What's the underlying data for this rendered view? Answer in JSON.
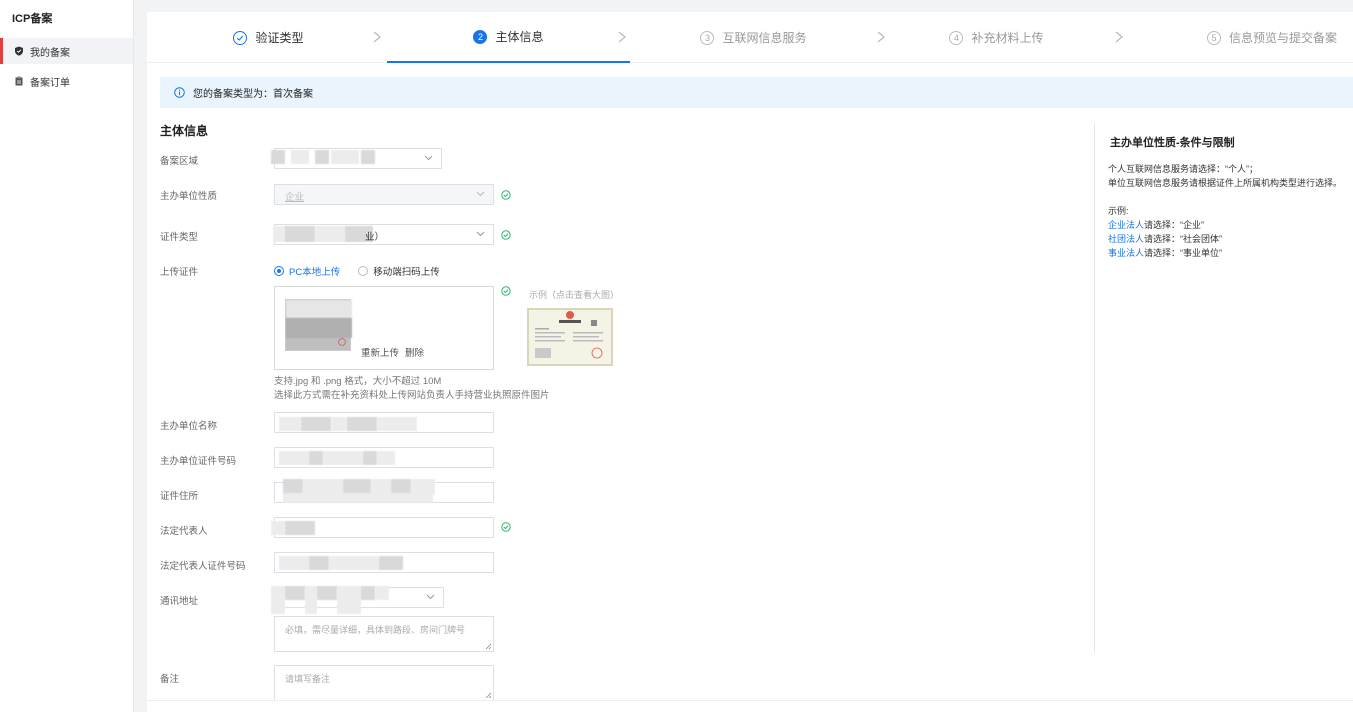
{
  "sidebar": {
    "title": "ICP备案",
    "items": [
      {
        "label": "我的备案",
        "icon": "shield-icon",
        "active": true
      },
      {
        "label": "备案订单",
        "icon": "clipboard-icon",
        "active": false
      }
    ]
  },
  "steps": [
    {
      "num": "✓",
      "label": "验证类型",
      "state": "done"
    },
    {
      "num": "2",
      "label": "主体信息",
      "state": "active"
    },
    {
      "num": "3",
      "label": "互联网信息服务",
      "state": "todo"
    },
    {
      "num": "4",
      "label": "补充材料上传",
      "state": "todo"
    },
    {
      "num": "5",
      "label": "信息预览与提交备案",
      "state": "todo"
    }
  ],
  "banner": {
    "text": "您的备案类型为：首次备案"
  },
  "form": {
    "section_title": "主体信息",
    "labels": {
      "region": "备案区域",
      "org_nature": "主办单位性质",
      "cert_type": "证件类型",
      "upload": "上传证件",
      "org_name": "主办单位名称",
      "org_cert_no": "主办单位证件号码",
      "cert_address": "证件住所",
      "legal_rep": "法定代表人",
      "legal_rep_cert_no": "法定代表人证件号码",
      "mail_address": "通讯地址",
      "remark": "备注"
    },
    "org_nature_value": "企业",
    "cert_type_suffix": "业）",
    "upload_options": {
      "pc": "PC本地上传",
      "mobile": "移动端扫码上传"
    },
    "upload_actions": {
      "reupload": "重新上传",
      "delete": "删除"
    },
    "upload_hint_1": "支持.jpg 和 .png 格式，大小不超过 10M",
    "upload_hint_2": "选择此方式需在补充资料处上传网站负责人手持营业执照原件图片",
    "example_label": "示例（点击查看大图）",
    "address_placeholder": "必填，需尽量详细，具体到路段、房间门牌号",
    "remark_placeholder": "请填写备注"
  },
  "right_panel": {
    "title": "主办单位性质-条件与限制",
    "line1": "个人互联网信息服务请选择：“个人”；",
    "line2": "单位互联网信息服务请根据证件上所属机构类型进行选择。",
    "example_title": "示例:",
    "examples": [
      {
        "link": "企业法人",
        "text": "请选择：“企业”"
      },
      {
        "link": "社团法人",
        "text": "请选择：“社会团体”"
      },
      {
        "link": "事业法人",
        "text": "请选择：“事业单位”"
      }
    ]
  },
  "colors": {
    "accent": "#1a73e8",
    "success": "#2eb872",
    "active_marker": "#e43f3f",
    "banner_bg": "#eaf4fd"
  }
}
